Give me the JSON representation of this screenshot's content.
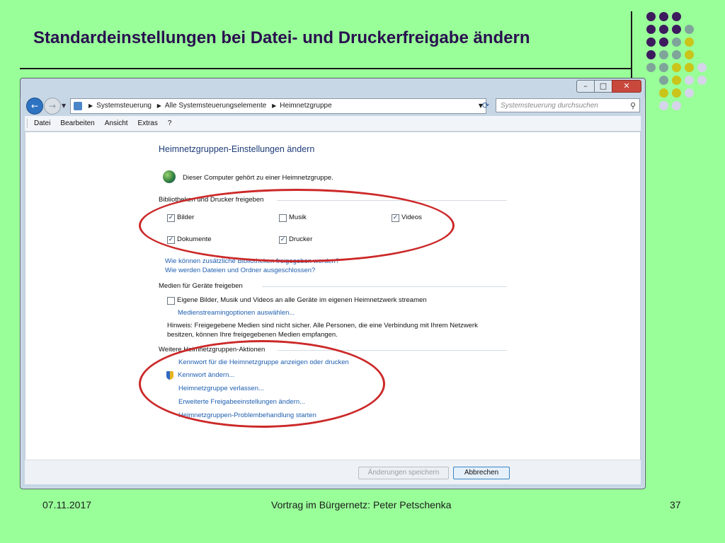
{
  "slide": {
    "title": "Standardeinstellungen bei Datei- und Druckerfreigabe ändern",
    "footer": {
      "date": "07.11.2017",
      "center": "Vortrag im Bürgernetz: Peter Petschenka",
      "page": "37"
    },
    "colors": {
      "background": "#99ff99",
      "dark_purple": "#3d1a5e",
      "grey_teal": "#7fa59a",
      "olive_yellow": "#c9c51a",
      "light_lilac": "#d6d4ea",
      "ellipse_red": "#cc2929"
    },
    "dot_grid": [
      [
        "dark_purple",
        "dark_purple",
        "dark_purple"
      ],
      [
        "dark_purple",
        "dark_purple",
        "dark_purple",
        "grey_teal"
      ],
      [
        "dark_purple",
        "dark_purple",
        "grey_teal",
        "olive_yellow"
      ],
      [
        "dark_purple",
        "grey_teal",
        "grey_teal",
        "olive_yellow"
      ],
      [
        "grey_teal",
        "grey_teal",
        "olive_yellow",
        "olive_yellow",
        "light_lilac"
      ],
      [
        "grey_teal",
        "olive_yellow",
        "light_lilac",
        "light_lilac"
      ],
      [
        "olive_yellow",
        "olive_yellow",
        "light_lilac"
      ],
      [
        "light_lilac",
        "light_lilac"
      ]
    ]
  },
  "window": {
    "controls": {
      "minimize": "–",
      "maximize": "□",
      "close": "✕"
    },
    "nav": {
      "back": "←",
      "forward": "→",
      "dropdown": "▼"
    },
    "address": {
      "crumbs": [
        "Systemsteuerung",
        "Alle Systemsteuerungselemente",
        "Heimnetzgruppe"
      ],
      "separator": "▶",
      "dropdown": "▼",
      "refresh": "⟳"
    },
    "search": {
      "placeholder": "Systemsteuerung durchsuchen",
      "icon": "search-icon",
      "icon_glyph": "⚲"
    },
    "menu": [
      "Datei",
      "Bearbeiten",
      "Ansicht",
      "Extras",
      "?"
    ]
  },
  "content": {
    "heading": "Heimnetzgruppen-Einstellungen ändern",
    "membership": "Dieser Computer gehört zu einer Heimnetzgruppe.",
    "share_group": "Bibliotheken und Drucker freigeben",
    "checkboxes": {
      "bilder": {
        "label": "Bilder",
        "checked": true,
        "mark": "✓"
      },
      "musik": {
        "label": "Musik",
        "checked": false,
        "mark": ""
      },
      "videos": {
        "label": "Videos",
        "checked": true,
        "mark": "✓"
      },
      "dokumente": {
        "label": "Dokumente",
        "checked": true,
        "mark": "✓"
      },
      "drucker": {
        "label": "Drucker",
        "checked": true,
        "mark": "✓"
      }
    },
    "share_links": [
      "Wie können zusätzliche Bibliotheken freigegeben werden?",
      "Wie werden Dateien und Ordner ausgeschlossen?"
    ],
    "media_group": "Medien für Geräte freigeben",
    "media_checkbox": {
      "label": "Eigene Bilder, Musik und Videos an alle Geräte im eigenen Heimnetzwerk streamen",
      "checked": false,
      "mark": ""
    },
    "media_link": "Medienstreamingoptionen auswählen...",
    "note_line1": "Hinweis: Freigegebene Medien sind nicht sicher. Alle Personen, die eine Verbindung mit Ihrem Netzwerk",
    "note_line2": "besitzen, können Ihre freigegebenen Medien empfangen.",
    "actions_group": "Weitere Heimnetzgruppen-Aktionen",
    "actions": [
      "Kennwort für die Heimnetzgruppe anzeigen oder drucken",
      "Kennwort ändern...",
      "Heimnetzgruppe verlassen...",
      "Erweiterte Freigabeeinstellungen ändern...",
      "Heimnetzgruppen-Problembehandlung starten"
    ],
    "buttons": {
      "save": "Änderungen speichern",
      "cancel": "Abbrechen"
    }
  }
}
